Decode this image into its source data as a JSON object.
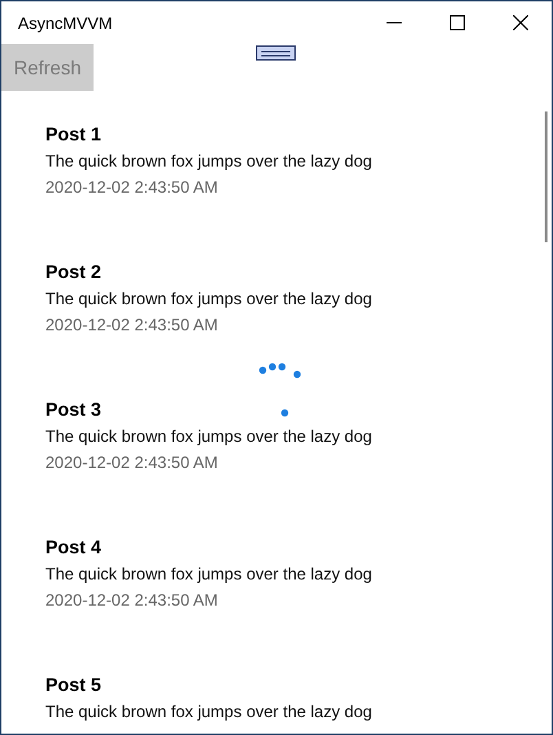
{
  "window": {
    "title": "AsyncMVVM"
  },
  "refresh_button": {
    "label": "Refresh",
    "disabled": true
  },
  "loading": true,
  "posts": [
    {
      "title": "Post 1",
      "body": "The quick brown fox jumps over the lazy dog",
      "date": "2020-12-02 2:43:50 AM"
    },
    {
      "title": "Post 2",
      "body": "The quick brown fox jumps over the lazy dog",
      "date": "2020-12-02 2:43:50 AM"
    },
    {
      "title": "Post 3",
      "body": "The quick brown fox jumps over the lazy dog",
      "date": "2020-12-02 2:43:50 AM"
    },
    {
      "title": "Post 4",
      "body": "The quick brown fox jumps over the lazy dog",
      "date": "2020-12-02 2:43:50 AM"
    },
    {
      "title": "Post 5",
      "body": "The quick brown fox jumps over the lazy dog"
    }
  ]
}
